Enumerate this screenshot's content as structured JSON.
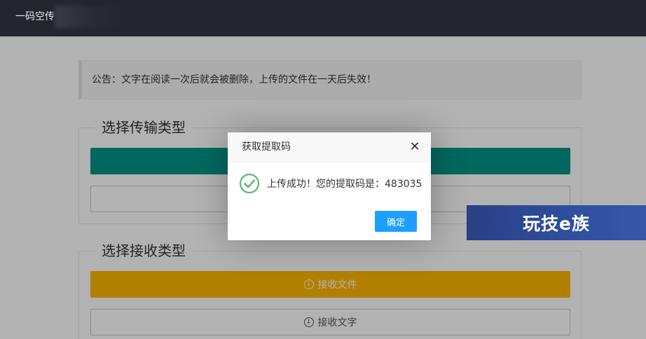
{
  "topbar": {
    "brand": "一码空传"
  },
  "notice": {
    "text": "公告：文字在阅读一次后就会被删除，上传的文件在一天后失效！"
  },
  "send_section": {
    "title": "选择传输类型",
    "primary_label": "",
    "secondary_label": ""
  },
  "receive_section": {
    "title": "选择接收类型",
    "receive_file_label": "接收文件",
    "receive_text_label": "接收文字"
  },
  "dialog": {
    "title": "获取提取码",
    "message": "上传成功！您的提取码是：483035",
    "ok_label": "确定",
    "close_icon": "close-icon",
    "status_icon": "check-circle-icon"
  },
  "watermark": {
    "text": "玩技e族"
  },
  "colors": {
    "topbar": "#23262e",
    "teal": "#009688",
    "amber": "#ffb800",
    "primary_blue": "#1e9fff",
    "success": "#5fb878"
  }
}
